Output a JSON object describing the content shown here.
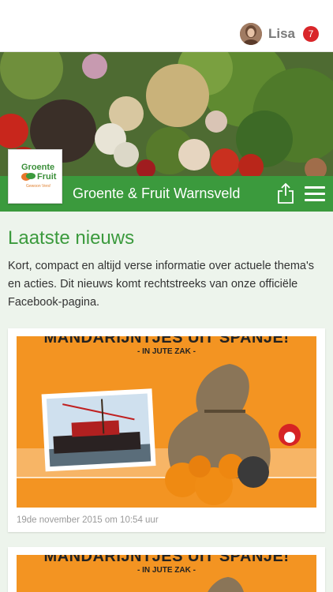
{
  "user": {
    "name": "Lisa",
    "notification_count": "7"
  },
  "store": {
    "name": "Groente & Fruit Warnsveld"
  },
  "logo": {
    "line1": "Groente",
    "line2": "Fruit",
    "tagline": "Gewoon Vers!"
  },
  "news": {
    "title": "Laatste nieuws",
    "intro": "Kort, compact en altijd verse informatie over actuele thema's en acties. Dit nieuws komt rechtstreeks van onze officiële Facebook-pagina.",
    "items": [
      {
        "headline": "MANDARIJNTJES UIT SPANJE!",
        "subheadline": "- IN JUTE ZAK -",
        "date": "19de november 2015 om 10:54 uur"
      },
      {
        "headline": "MANDARIJNTJES UIT SPANJE!",
        "subheadline": "- IN JUTE ZAK -"
      }
    ]
  },
  "colors": {
    "brand_green": "#3b9a3d",
    "badge_red": "#d9262a",
    "banner_orange": "#f39422"
  },
  "icons": {
    "share": "share-icon",
    "menu": "hamburger-menu-icon"
  }
}
